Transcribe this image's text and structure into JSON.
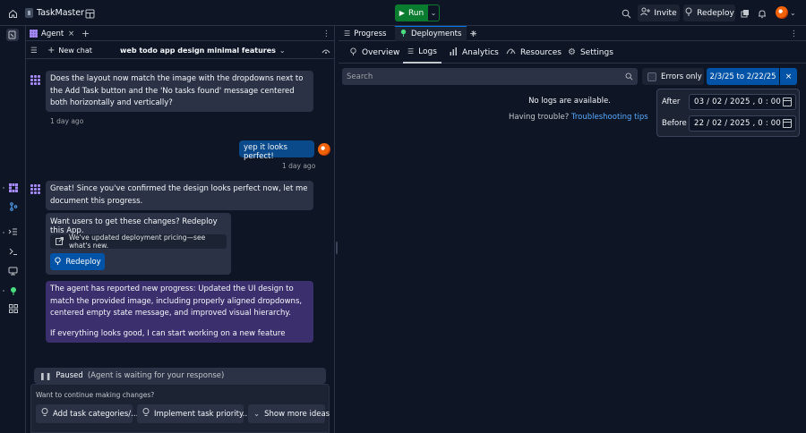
{
  "app": {
    "name": "TaskMaster"
  },
  "topbar": {
    "run_label": "Run",
    "invite_label": "Invite",
    "redeploy_label": "Redeploy"
  },
  "agent_panel": {
    "tab_label": "Agent",
    "new_chat_label": "New chat",
    "chat_title": "web todo app design minimal features",
    "messages": [
      {
        "text": "Does the layout now match the image with the dropdowns next to the Add Task button and the 'No tasks found' message centered both horizontally and vertically?",
        "time": "1 day ago"
      },
      {
        "text": "yep it looks perfect!",
        "time": "1 day ago"
      },
      {
        "text": "Great! Since you've confirmed the design looks perfect now, let me document this progress."
      }
    ],
    "redeploy_card": {
      "title": "Want users to get these changes? Redeploy this App.",
      "pricing_note": "We've updated deployment pricing—see what's new.",
      "button_label": "Redeploy"
    },
    "progress_message": {
      "p1": "The agent has reported new progress: Updated the UI design to match the provided image, including properly aligned dropdowns, centered empty state message, and improved visual hierarchy.",
      "p2": "If everything looks good, I can start working on a new feature"
    },
    "paused": {
      "label": "Paused",
      "note": "(Agent is waiting for your response)"
    },
    "suggestions": {
      "title": "Want to continue making changes?",
      "items": [
        "Add task categories/...",
        "Implement task priority...",
        "Show more ideas"
      ]
    }
  },
  "right_panel": {
    "tabs": [
      "Progress",
      "Deployments"
    ],
    "nav": [
      "Overview",
      "Logs",
      "Analytics",
      "Resources",
      "Settings"
    ],
    "search_placeholder": "Search",
    "errors_only_label": "Errors only",
    "date_range": "2/3/25 to 2/22/25",
    "empty_message": "No logs are available.",
    "trouble_text": "Having trouble?",
    "trouble_link": "Troubleshooting tips",
    "date_popover": {
      "after_label": "After",
      "after_value": "03 / 02 / 2025 , 0 : 00",
      "before_label": "Before",
      "before_value": "22 / 02 / 2025 , 0 : 00"
    }
  },
  "colors": {
    "background": "#0e1525",
    "surface": "#2b3245",
    "run_green": "#0a7c2f",
    "primary_blue": "#0053a6",
    "link_blue": "#57abff",
    "agent_purple": "#a78bfa"
  }
}
